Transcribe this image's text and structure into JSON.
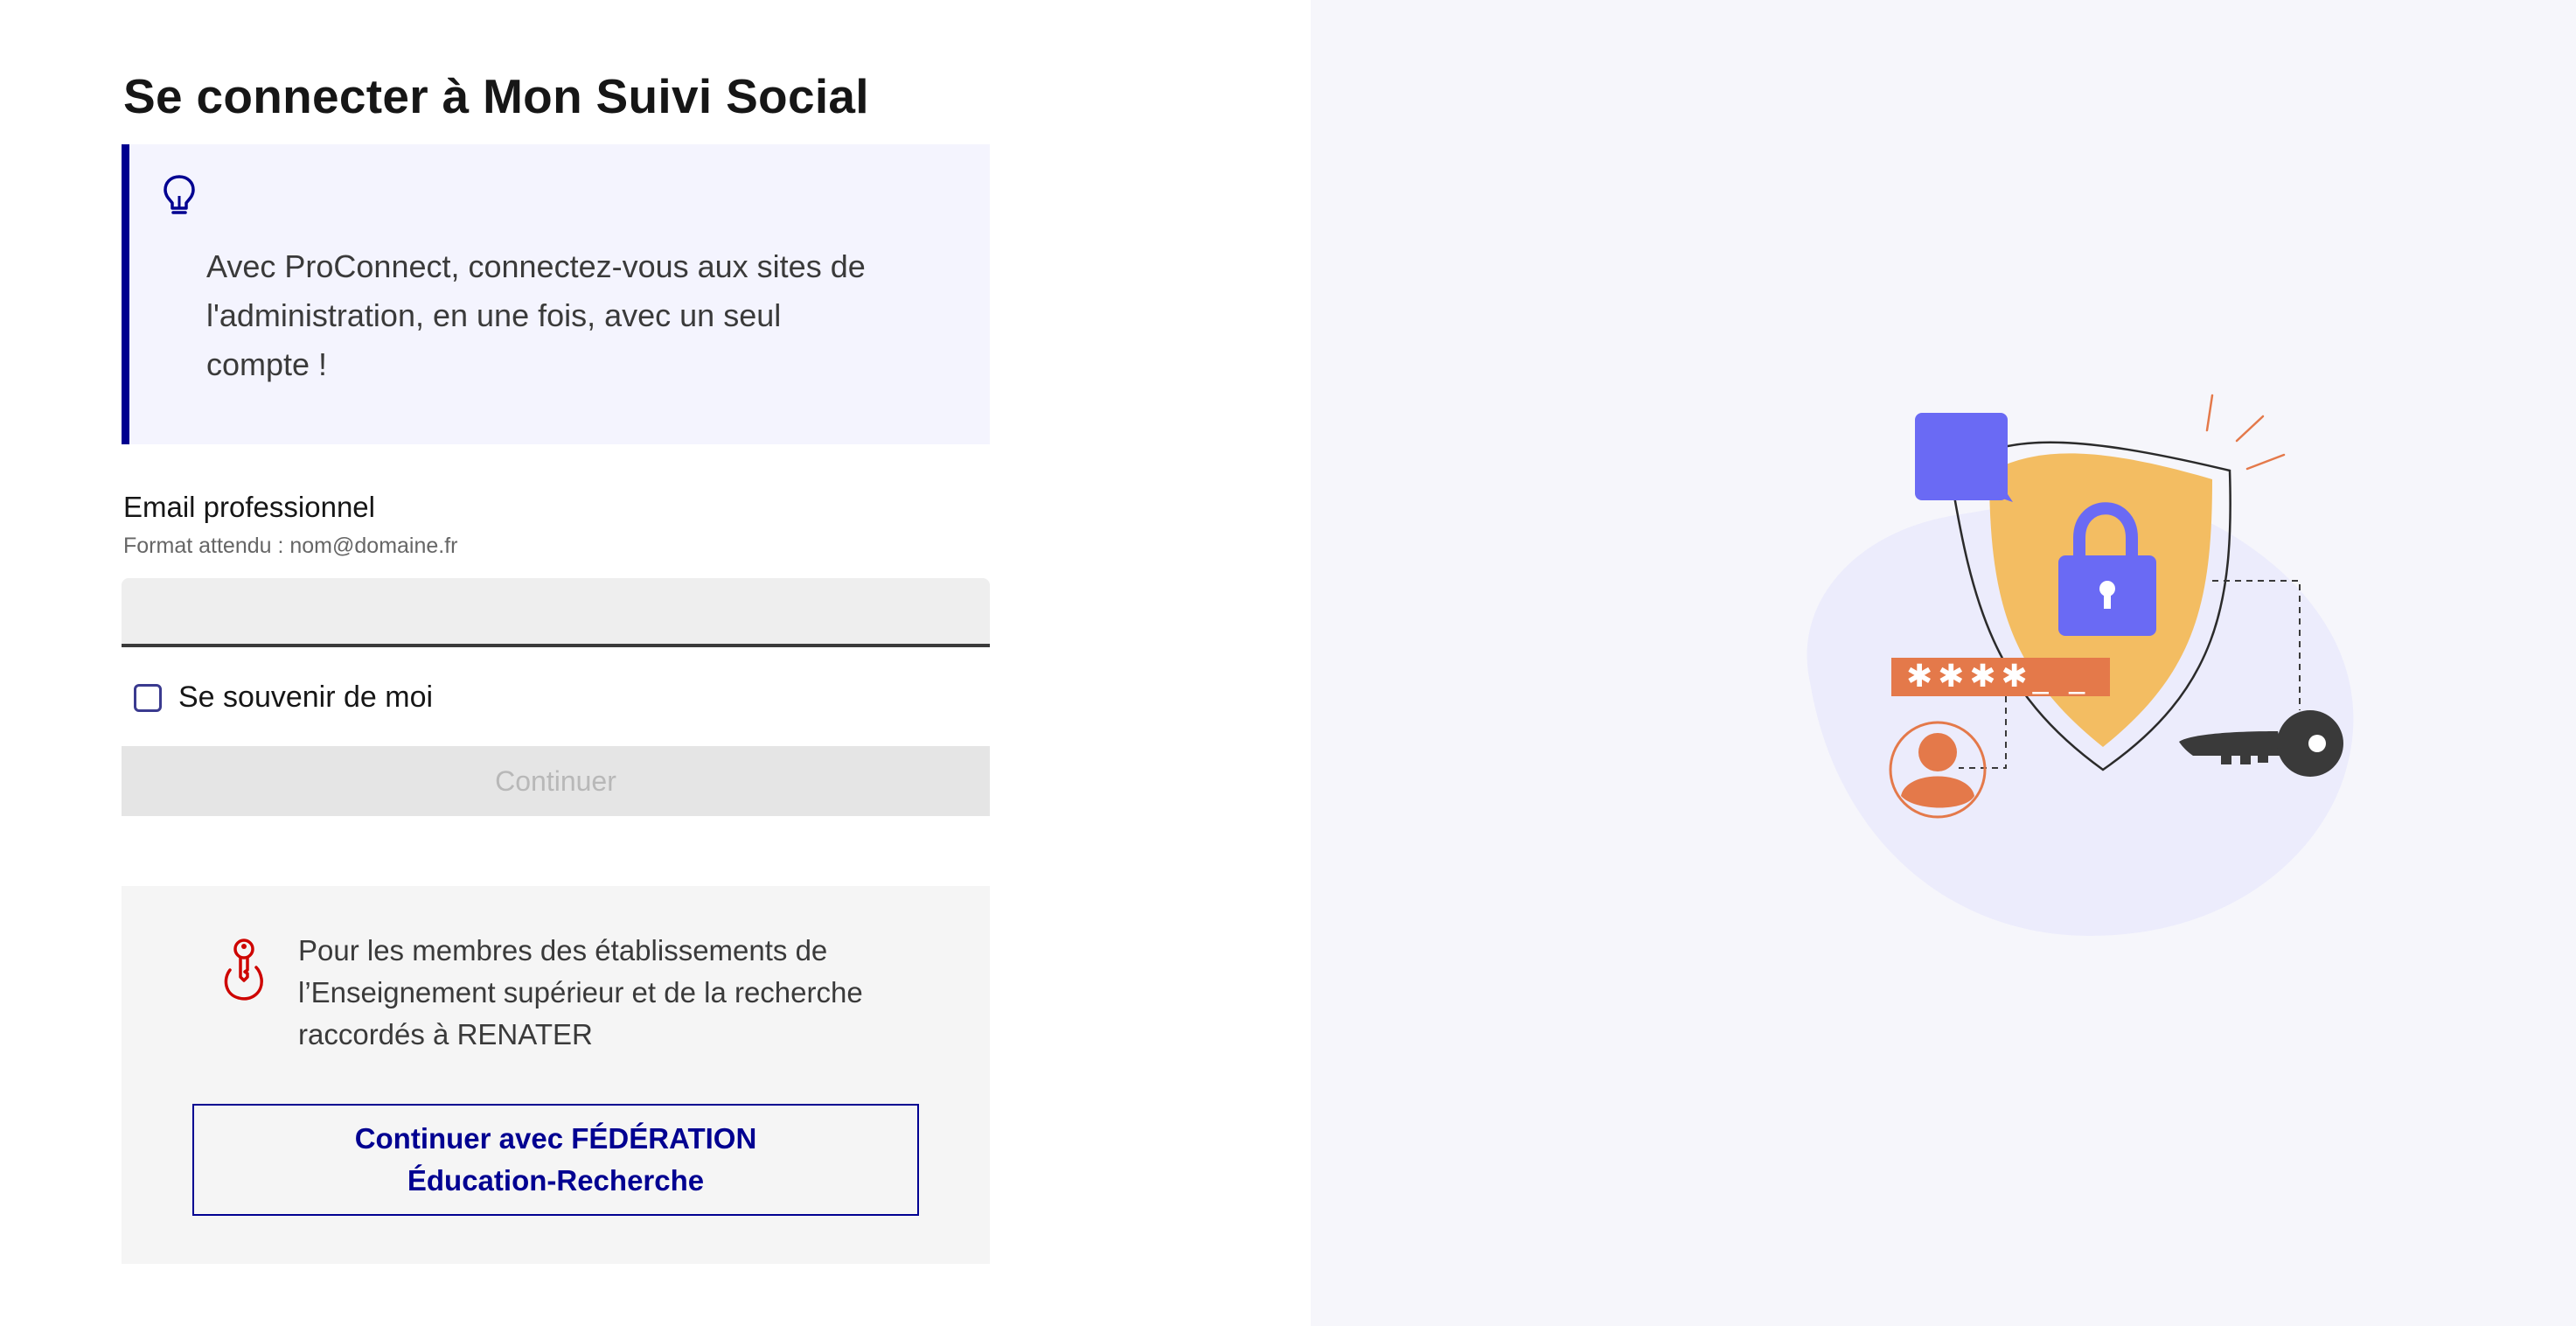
{
  "page": {
    "title": "Se connecter à Mon Suivi Social"
  },
  "callout": {
    "icon": "lightbulb-icon",
    "text": "Avec ProConnect, connectez-vous aux sites de l'administration, en une fois, avec un seul compte !"
  },
  "form": {
    "email_label": "Email professionnel",
    "email_hint": "Format attendu : nom@domaine.fr",
    "email_value": "",
    "email_placeholder": "",
    "remember_label": "Se souvenir de moi",
    "remember_checked": false,
    "continue_label": "Continuer",
    "continue_disabled": true
  },
  "federation": {
    "icon": "key-icon",
    "text": "Pour les membres des établissements de l’Enseignement supérieur et de la recherche raccordés à RENATER",
    "button_line1": "Continuer avec FÉDÉRATION",
    "button_line2": "Éducation-Recherche"
  },
  "illustration": {
    "password_mask": "✱✱✱✱_ _",
    "colors": {
      "accent_blue": "#000091",
      "shield_yellow": "#f3bd62",
      "lock_purple": "#6a6af4",
      "orange": "#e4794a",
      "blob": "#ececfc",
      "key_dark": "#3a3a3a"
    }
  }
}
